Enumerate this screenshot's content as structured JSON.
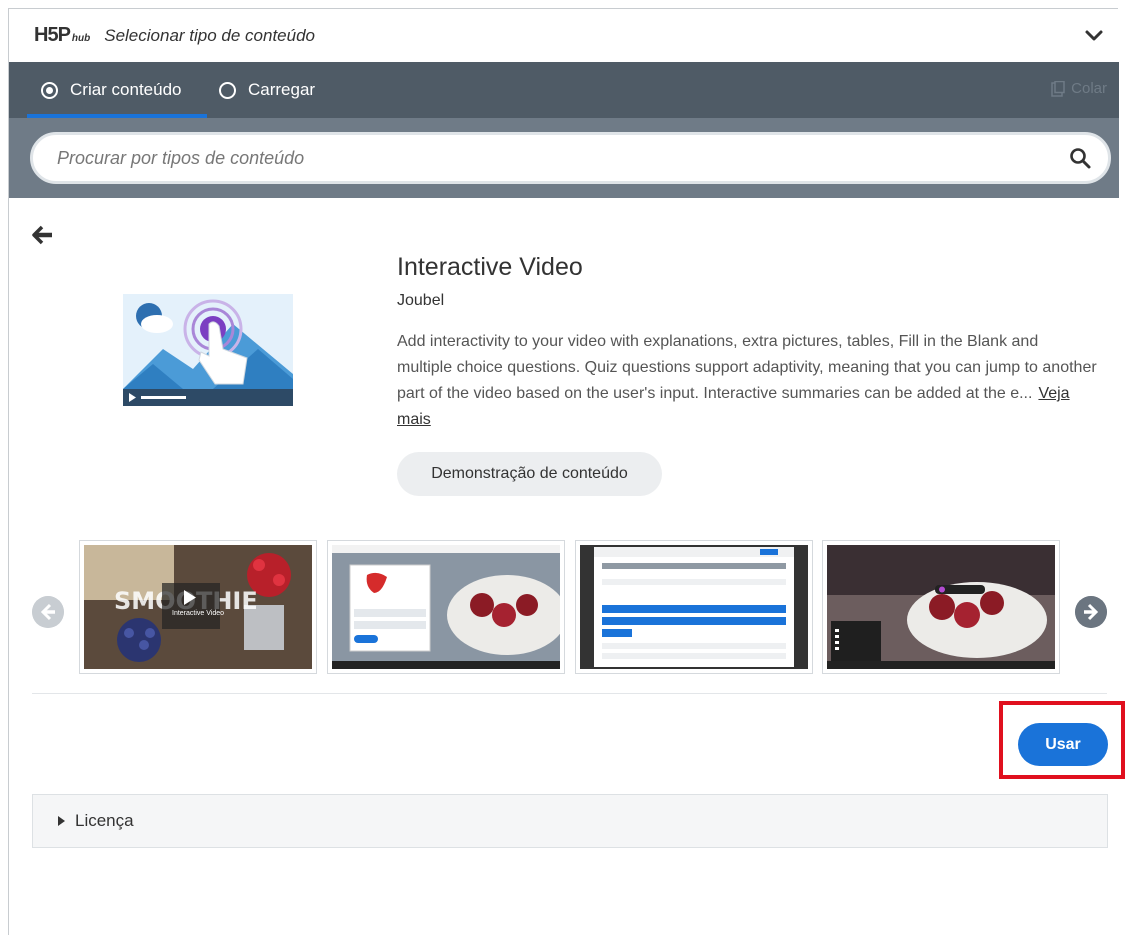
{
  "header": {
    "logo_text": "H5P",
    "logo_hub": "hub",
    "title": "Selecionar tipo de conteúdo",
    "toggle_icon": "chevron-down-icon"
  },
  "tabs": [
    {
      "label": "Criar conteúdo",
      "selected": true
    },
    {
      "label": "Carregar",
      "selected": false
    }
  ],
  "paste": {
    "label": "Colar",
    "enabled": false
  },
  "search": {
    "placeholder": "Procurar por tipos de conteúdo",
    "value": ""
  },
  "detail": {
    "title": "Interactive Video",
    "owner": "Joubel",
    "description": "Add interactivity to your video with explanations, extra pictures, tables, Fill in the Blank and multiple choice questions. Quiz questions support adaptivity, meaning that you can jump to another part of the video based on the user's input. Interactive summaries can be added at the e...",
    "read_more": "Veja mais",
    "demo_label": "Demonstração de conteúdo"
  },
  "screenshots": [
    {
      "name": "smoothie-video",
      "overlay_text": "Interactive Video"
    },
    {
      "name": "strawberry-question",
      "question": "What kind of berry is this?",
      "options": [
        "Strawberry",
        "Blueberry"
      ],
      "check": "Check"
    },
    {
      "name": "editor-form",
      "title": "Multiple Choice"
    },
    {
      "name": "bookmarks-video",
      "bookmarks_title": "Bookmarks",
      "bookmarks": [
        "Recipe",
        "Preparing",
        "Mixing",
        "Serving"
      ],
      "tag": "Smoothie Tutorial"
    }
  ],
  "use_label": "Usar",
  "license": {
    "label": "Licença"
  },
  "colors": {
    "accent": "#1a73d9",
    "tab_bar": "#4f5b66",
    "search_bar": "#6f7b87",
    "highlight": "#e0101e"
  }
}
